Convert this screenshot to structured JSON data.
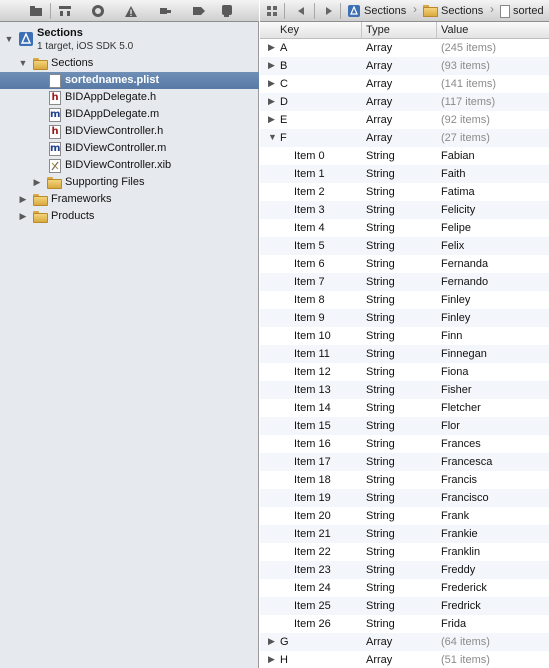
{
  "navigator": {
    "toolbar_icons": [
      "folder-icon",
      "hierarchy-icon",
      "symbol-search-icon",
      "warning-icon",
      "tag-icon",
      "log-icon"
    ],
    "project": {
      "name": "Sections",
      "subtitle": "1 target, iOS SDK 5.0"
    },
    "items": [
      {
        "label": "Sections",
        "kind": "folder",
        "expanded": true
      },
      {
        "label": "sortednames.plist",
        "kind": "plist",
        "selected": true
      },
      {
        "label": "BIDAppDelegate.h",
        "kind": "h"
      },
      {
        "label": "BIDAppDelegate.m",
        "kind": "m"
      },
      {
        "label": "BIDViewController.h",
        "kind": "h"
      },
      {
        "label": "BIDViewController.m",
        "kind": "m"
      },
      {
        "label": "BIDViewController.xib",
        "kind": "xib"
      },
      {
        "label": "Supporting Files",
        "kind": "folder",
        "expanded": false
      },
      {
        "label": "Frameworks",
        "kind": "folder",
        "expanded": false
      },
      {
        "label": "Products",
        "kind": "folder",
        "expanded": false
      }
    ]
  },
  "jumpbar": {
    "crumbs": [
      "Sections",
      "Sections",
      "sorted"
    ]
  },
  "plist": {
    "headers": {
      "key": "Key",
      "type": "Type",
      "value": "Value"
    },
    "rows": [
      {
        "key": "A",
        "type": "Array",
        "value": "(245 items)",
        "level": 0,
        "disclosure": "collapsed"
      },
      {
        "key": "B",
        "type": "Array",
        "value": "(93 items)",
        "level": 0,
        "disclosure": "collapsed"
      },
      {
        "key": "C",
        "type": "Array",
        "value": "(141 items)",
        "level": 0,
        "disclosure": "collapsed"
      },
      {
        "key": "D",
        "type": "Array",
        "value": "(117 items)",
        "level": 0,
        "disclosure": "collapsed"
      },
      {
        "key": "E",
        "type": "Array",
        "value": "(92 items)",
        "level": 0,
        "disclosure": "collapsed"
      },
      {
        "key": "F",
        "type": "Array",
        "value": "(27 items)",
        "level": 0,
        "disclosure": "expanded"
      },
      {
        "key": "Item 0",
        "type": "String",
        "value": "Fabian",
        "level": 1
      },
      {
        "key": "Item 1",
        "type": "String",
        "value": "Faith",
        "level": 1
      },
      {
        "key": "Item 2",
        "type": "String",
        "value": "Fatima",
        "level": 1
      },
      {
        "key": "Item 3",
        "type": "String",
        "value": "Felicity",
        "level": 1
      },
      {
        "key": "Item 4",
        "type": "String",
        "value": "Felipe",
        "level": 1
      },
      {
        "key": "Item 5",
        "type": "String",
        "value": "Felix",
        "level": 1
      },
      {
        "key": "Item 6",
        "type": "String",
        "value": "Fernanda",
        "level": 1
      },
      {
        "key": "Item 7",
        "type": "String",
        "value": "Fernando",
        "level": 1
      },
      {
        "key": "Item 8",
        "type": "String",
        "value": "Finley",
        "level": 1
      },
      {
        "key": "Item 9",
        "type": "String",
        "value": "Finley",
        "level": 1
      },
      {
        "key": "Item 10",
        "type": "String",
        "value": "Finn",
        "level": 1
      },
      {
        "key": "Item 11",
        "type": "String",
        "value": "Finnegan",
        "level": 1
      },
      {
        "key": "Item 12",
        "type": "String",
        "value": "Fiona",
        "level": 1
      },
      {
        "key": "Item 13",
        "type": "String",
        "value": "Fisher",
        "level": 1
      },
      {
        "key": "Item 14",
        "type": "String",
        "value": "Fletcher",
        "level": 1
      },
      {
        "key": "Item 15",
        "type": "String",
        "value": "Flor",
        "level": 1
      },
      {
        "key": "Item 16",
        "type": "String",
        "value": "Frances",
        "level": 1
      },
      {
        "key": "Item 17",
        "type": "String",
        "value": "Francesca",
        "level": 1
      },
      {
        "key": "Item 18",
        "type": "String",
        "value": "Francis",
        "level": 1
      },
      {
        "key": "Item 19",
        "type": "String",
        "value": "Francisco",
        "level": 1
      },
      {
        "key": "Item 20",
        "type": "String",
        "value": "Frank",
        "level": 1
      },
      {
        "key": "Item 21",
        "type": "String",
        "value": "Frankie",
        "level": 1
      },
      {
        "key": "Item 22",
        "type": "String",
        "value": "Franklin",
        "level": 1
      },
      {
        "key": "Item 23",
        "type": "String",
        "value": "Freddy",
        "level": 1
      },
      {
        "key": "Item 24",
        "type": "String",
        "value": "Frederick",
        "level": 1
      },
      {
        "key": "Item 25",
        "type": "String",
        "value": "Fredrick",
        "level": 1
      },
      {
        "key": "Item 26",
        "type": "String",
        "value": "Frida",
        "level": 1
      },
      {
        "key": "G",
        "type": "Array",
        "value": "(64 items)",
        "level": 0,
        "disclosure": "collapsed"
      },
      {
        "key": "H",
        "type": "Array",
        "value": "(51 items)",
        "level": 0,
        "disclosure": "collapsed"
      }
    ]
  },
  "colors": {
    "selection": "#5b7ca8",
    "folder": "#e8bf55",
    "h_file": "#9b1c1c",
    "m_file": "#1f3f8f"
  }
}
